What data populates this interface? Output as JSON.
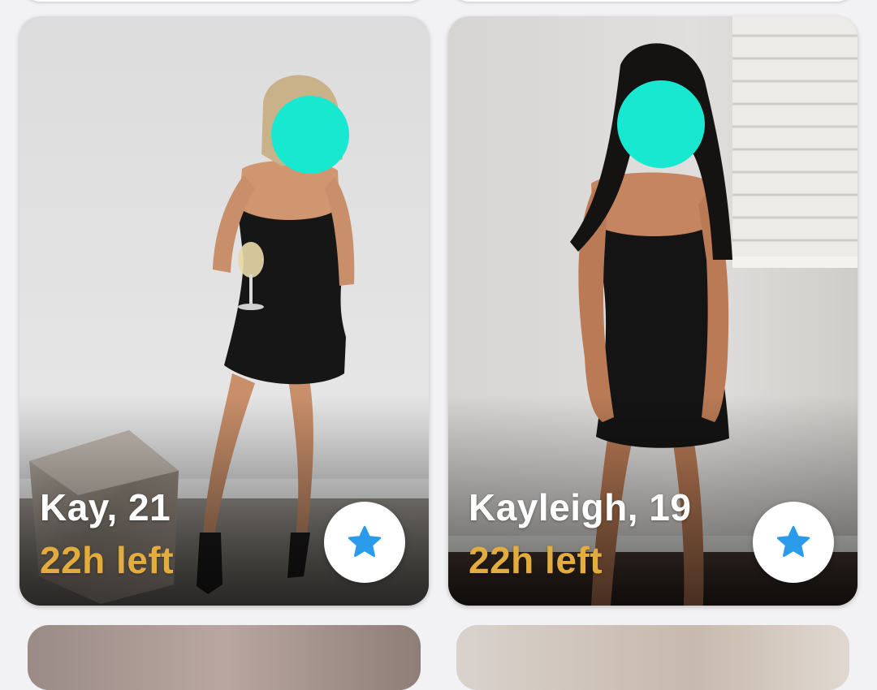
{
  "cards": [
    {
      "name_age": "Kay, 21",
      "time_left": "22h left",
      "action_icon": "star-icon"
    },
    {
      "name_age": "Kayleigh, 19",
      "time_left": "22h left",
      "action_icon": "star-icon"
    }
  ],
  "colors": {
    "time_left": "#e2ac3e",
    "star_icon": "#2a9bea",
    "face_blur": "#19e8d0"
  }
}
